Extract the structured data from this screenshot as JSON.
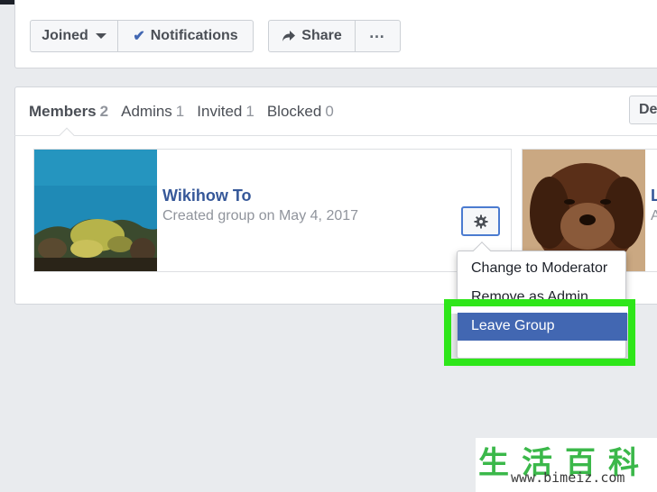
{
  "header": {
    "joined_label": "Joined",
    "notifications_label": "Notifications",
    "share_label": "Share",
    "more_label": "…"
  },
  "tabs": [
    {
      "label": "Members",
      "count": "2"
    },
    {
      "label": "Admins",
      "count": "1"
    },
    {
      "label": "Invited",
      "count": "1"
    },
    {
      "label": "Blocked",
      "count": "0"
    }
  ],
  "right_button_label": "De",
  "members": [
    {
      "name": "Wikihow To",
      "subtitle": "Created group on May 4, 2017"
    },
    {
      "name": "L",
      "subtitle": "A"
    }
  ],
  "dropdown": {
    "items": [
      "Change to Moderator",
      "Remove as Admin",
      "Leave Group"
    ],
    "highlighted": "Leave Group"
  },
  "watermark": {
    "chinese": "生活百科",
    "url": "www.bimeiz.com"
  },
  "colors": {
    "accent": "#4267b2",
    "highlight": "#2ee619",
    "link": "#365899",
    "background": "#e9ebee"
  }
}
